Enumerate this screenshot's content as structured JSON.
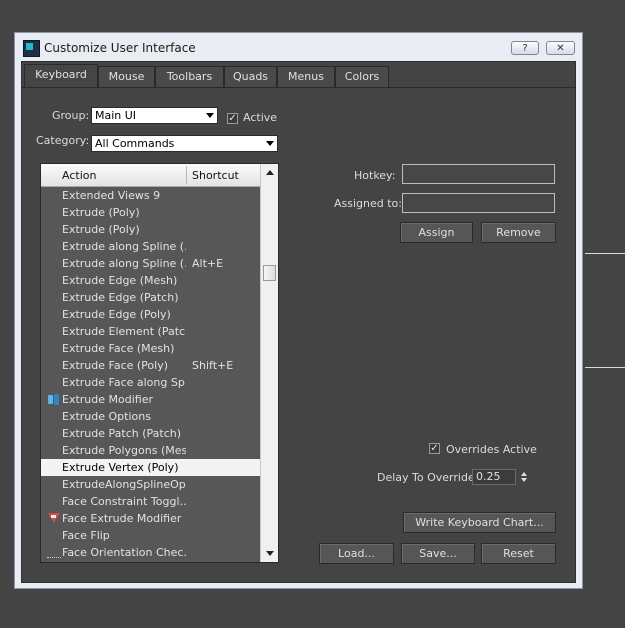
{
  "window": {
    "title": "Customize User Interface",
    "help_label": "?",
    "close_label": "✕"
  },
  "tabs": [
    {
      "label": "Keyboard",
      "active": true
    },
    {
      "label": "Mouse"
    },
    {
      "label": "Toolbars"
    },
    {
      "label": "Quads"
    },
    {
      "label": "Menus"
    },
    {
      "label": "Colors"
    }
  ],
  "group": {
    "label": "Group:",
    "value": "Main UI"
  },
  "active_checkbox": {
    "label": "Active",
    "checked": true
  },
  "category": {
    "label": "Category:",
    "value": "All Commands"
  },
  "list": {
    "columns": {
      "action": "Action",
      "shortcut": "Shortcut"
    },
    "rows": [
      {
        "action": "Extended Views 9",
        "shortcut": ""
      },
      {
        "action": "Extrude (Poly)",
        "shortcut": ""
      },
      {
        "action": "Extrude (Poly)",
        "shortcut": ""
      },
      {
        "action": "Extrude along Spline (…",
        "shortcut": ""
      },
      {
        "action": "Extrude along Spline (…",
        "shortcut": "Alt+E"
      },
      {
        "action": "Extrude Edge (Mesh)",
        "shortcut": ""
      },
      {
        "action": "Extrude Edge (Patch)",
        "shortcut": ""
      },
      {
        "action": "Extrude Edge (Poly)",
        "shortcut": ""
      },
      {
        "action": "Extrude Element (Patch)",
        "shortcut": ""
      },
      {
        "action": "Extrude Face (Mesh)",
        "shortcut": ""
      },
      {
        "action": "Extrude Face (Poly)",
        "shortcut": "Shift+E"
      },
      {
        "action": "Extrude Face along Sp…",
        "shortcut": ""
      },
      {
        "action": "Extrude Modifier",
        "shortcut": "",
        "icon": "extrude-modifier-icon"
      },
      {
        "action": "Extrude Options",
        "shortcut": ""
      },
      {
        "action": "Extrude Patch (Patch)",
        "shortcut": ""
      },
      {
        "action": "Extrude Polygons (Mesh)",
        "shortcut": ""
      },
      {
        "action": "Extrude Vertex (Poly)",
        "shortcut": "",
        "selected": true
      },
      {
        "action": "ExtrudeAlongSplineOp…",
        "shortcut": ""
      },
      {
        "action": "Face Constraint Toggl…",
        "shortcut": ""
      },
      {
        "action": "Face Extrude Modifier",
        "shortcut": "",
        "icon": "face-extrude-modifier-icon"
      },
      {
        "action": "Face Flip",
        "shortcut": ""
      },
      {
        "action": "Face Orientation Chec…",
        "shortcut": ""
      }
    ]
  },
  "hotkey": {
    "label": "Hotkey:",
    "value": ""
  },
  "assigned_to": {
    "label": "Assigned to:",
    "value": ""
  },
  "buttons": {
    "assign": "Assign",
    "remove": "Remove",
    "write_chart": "Write Keyboard Chart...",
    "load": "Load...",
    "save": "Save...",
    "reset": "Reset"
  },
  "overrides_active": {
    "label": "Overrides Active",
    "checked": true
  },
  "delay_to_override": {
    "label": "Delay To Override:",
    "value": "0.25"
  }
}
